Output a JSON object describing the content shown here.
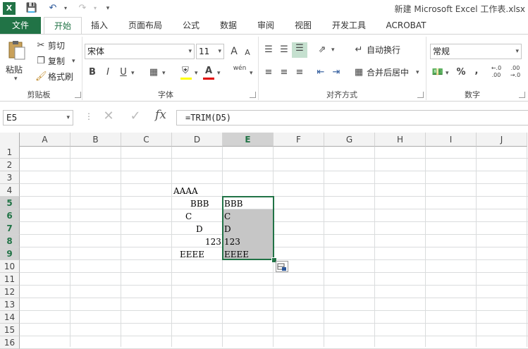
{
  "title_bar": {
    "title": "新建 Microsoft Excel 工作表.xlsx"
  },
  "tabs": [
    {
      "label": "文件"
    },
    {
      "label": "开始"
    },
    {
      "label": "插入"
    },
    {
      "label": "页面布局"
    },
    {
      "label": "公式"
    },
    {
      "label": "数据"
    },
    {
      "label": "审阅"
    },
    {
      "label": "视图"
    },
    {
      "label": "开发工具"
    },
    {
      "label": "ACROBAT"
    }
  ],
  "ribbon": {
    "clipboard": {
      "paste": "粘贴",
      "cut": "剪切",
      "copy": "复制",
      "format_painter": "格式刷",
      "group": "剪贴板"
    },
    "font": {
      "font_name": "宋体",
      "font_size": "11",
      "bold": "B",
      "italic": "I",
      "underline": "U",
      "phonetic": "wén",
      "group": "字体",
      "grow": "A",
      "shrink": "A"
    },
    "alignment": {
      "wrap": "自动换行",
      "merge": "合并后居中",
      "group": "对齐方式"
    },
    "number": {
      "format": "常规",
      "percent": "%",
      "comma": ",",
      "group": "数字"
    }
  },
  "formula_bar": {
    "name_box": "E5",
    "fx": "fx",
    "formula": "=TRIM(D5)"
  },
  "columns": [
    "A",
    "B",
    "C",
    "D",
    "E",
    "F",
    "G",
    "H",
    "I",
    "J"
  ],
  "rows": [
    "1",
    "2",
    "3",
    "4",
    "5",
    "6",
    "7",
    "8",
    "9",
    "10",
    "11",
    "12",
    "13",
    "14",
    "15",
    "16"
  ],
  "cells": {
    "D4": "AAAA",
    "D5": "BBB",
    "D6": "C",
    "D7": "D",
    "D8": "123",
    "D9": "EEEE",
    "E5": "BBB",
    "E6": "C",
    "E7": "D",
    "E8": "123",
    "E9": "EEEE"
  },
  "colors": {
    "accent": "#217346",
    "selection_fill": "#c6c6c6"
  }
}
